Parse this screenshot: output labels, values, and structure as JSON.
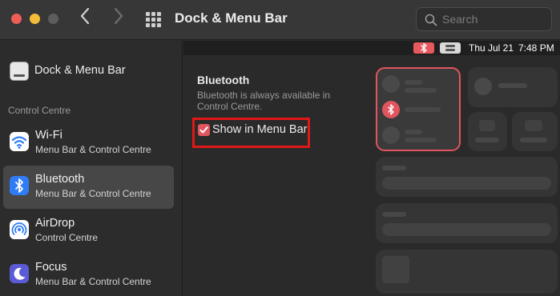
{
  "window": {
    "title": "Dock & Menu Bar",
    "search_placeholder": "Search"
  },
  "icons": {
    "back": "chevron-left-icon",
    "forward": "chevron-right-icon",
    "grid": "grid-icon",
    "search": "search-icon"
  },
  "sidebar": {
    "top_item": "Dock & Menu Bar",
    "section_label": "Control Centre",
    "items": [
      {
        "title": "Wi-Fi",
        "subtitle": "Menu Bar & Control Centre",
        "icon": "wifi-icon",
        "selected": false
      },
      {
        "title": "Bluetooth",
        "subtitle": "Menu Bar & Control Centre",
        "icon": "bluetooth-icon",
        "selected": true
      },
      {
        "title": "AirDrop",
        "subtitle": "Control Centre",
        "icon": "airdrop-icon",
        "selected": false
      },
      {
        "title": "Focus",
        "subtitle": "Menu Bar & Control Centre",
        "icon": "focus-moon-icon",
        "selected": false
      }
    ]
  },
  "menubar": {
    "date": "Thu Jul 21",
    "time": "7:48 PM"
  },
  "detail": {
    "title": "Bluetooth",
    "description": "Bluetooth is always available in Control Centre.",
    "checkbox_label": "Show in Menu Bar",
    "checkbox_checked": true
  },
  "colors": {
    "accent": "#e0555e",
    "highlight": "#e01818",
    "bluetooth_blue": "#2f7cf6"
  }
}
